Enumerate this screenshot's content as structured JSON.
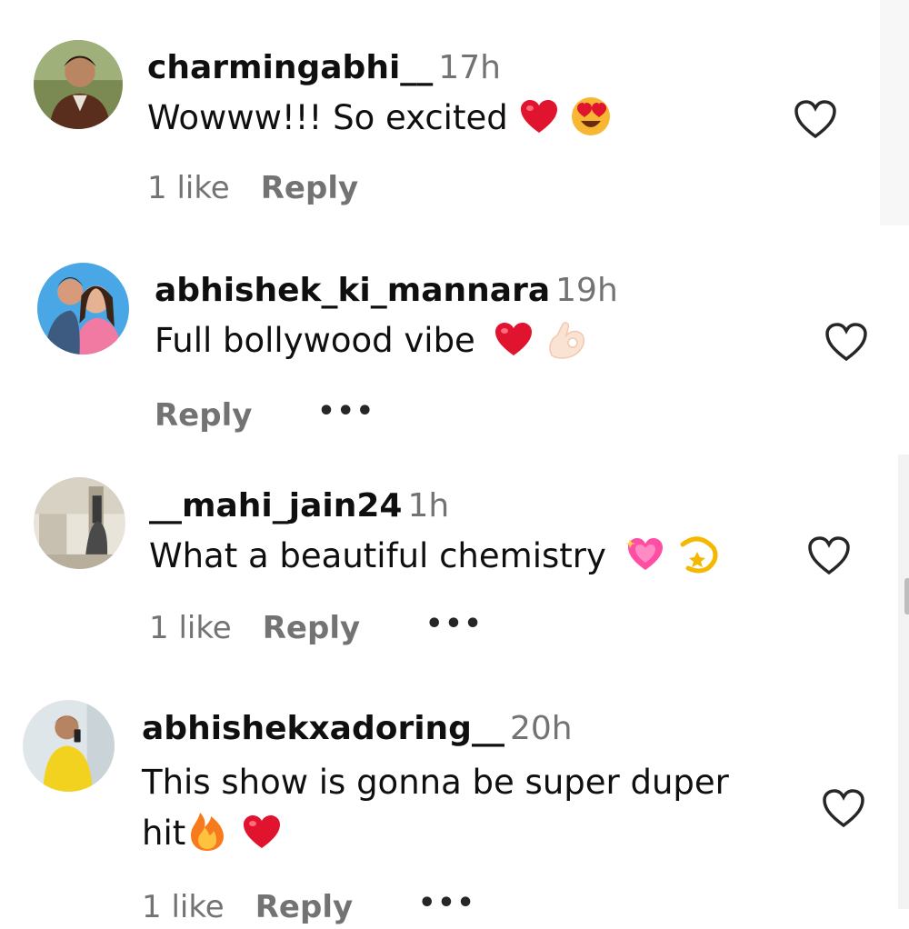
{
  "comments": [
    {
      "username": "charmingabhi__",
      "time": "17h",
      "text": "Wowww!!! So excited",
      "emojis": [
        "red-heart",
        "heart-eyes-face"
      ],
      "likes": "1 like",
      "reply": "Reply",
      "more": ""
    },
    {
      "username": "abhishek_ki_mannara",
      "time": "19h",
      "text": "Full bollywood vibe",
      "emojis": [
        "red-heart",
        "ok-hand"
      ],
      "likes": "",
      "reply": "Reply",
      "more": "•••"
    },
    {
      "username": "__mahi_jain24",
      "time": "1h",
      "text": "What a beautiful chemistry",
      "emojis": [
        "sparkling-heart",
        "dizzy"
      ],
      "likes": "1 like",
      "reply": "Reply",
      "more": "•••"
    },
    {
      "username": "abhishekxadoring__",
      "time": "20h",
      "text_line1": "This show is gonna be super duper",
      "text_line2": "hit",
      "emojis": [
        "fire",
        "red-heart"
      ],
      "likes": "1 like",
      "reply": "Reply",
      "more": "•••"
    }
  ],
  "icons": {
    "like": "heart-outline-icon",
    "more": "more-options-icon"
  },
  "colors": {
    "text": "#0f0f0f",
    "secondary": "#737373",
    "heart": "#e0142e",
    "icon": "#262626"
  }
}
